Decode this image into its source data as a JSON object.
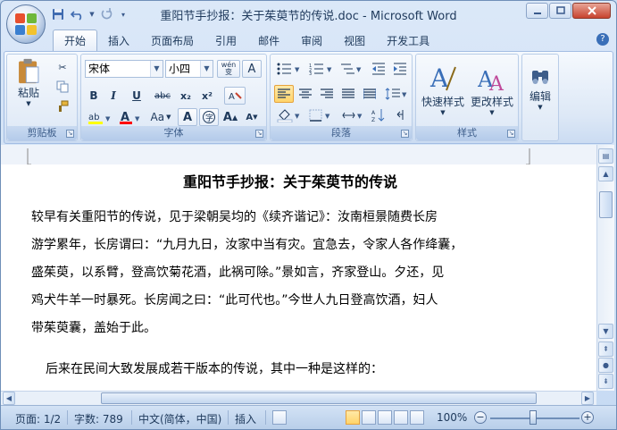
{
  "window": {
    "title": "重阳节手抄报：关于茱萸节的传说.doc - Microsoft Word"
  },
  "quick_access": {
    "icons": [
      "save-icon",
      "undo-icon",
      "redo-icon",
      "customize-icon"
    ]
  },
  "tabs": [
    {
      "label": "开始",
      "active": true
    },
    {
      "label": "插入",
      "active": false
    },
    {
      "label": "页面布局",
      "active": false
    },
    {
      "label": "引用",
      "active": false
    },
    {
      "label": "邮件",
      "active": false
    },
    {
      "label": "审阅",
      "active": false
    },
    {
      "label": "视图",
      "active": false
    },
    {
      "label": "开发工具",
      "active": false
    }
  ],
  "ribbon": {
    "clipboard": {
      "label": "剪贴板",
      "paste_label": "粘贴"
    },
    "font": {
      "label": "字体",
      "font_name": "宋体",
      "font_size": "小四",
      "wen_label": "wén 变",
      "a_label": "A",
      "bold": "B",
      "italic": "I",
      "underline": "U",
      "strike": "abc",
      "subscript": "x₂",
      "superscript": "x²",
      "aa_label": "Aa",
      "grow": "A",
      "shrink": "A",
      "highlight_color": "#ffff00",
      "font_color": "#ff0000"
    },
    "paragraph": {
      "label": "段落"
    },
    "styles": {
      "label": "样式",
      "quick_styles": "快速样式",
      "change_styles": "更改样式"
    },
    "editing": {
      "label": "编辑"
    }
  },
  "document": {
    "title": "重阳节手抄报：关于茱萸节的传说",
    "lines": [
      "较早有关重阳节的传说，见于梁朝吴均的《续齐谐记》：汝南桓景随费长房",
      "游学累年，长房谓曰：“九月九日，汝家中当有灾。宜急去，令家人各作绛囊，",
      "盛茱萸，以系臂，登高饮菊花酒，此祸可除。”景如言，齐家登山。夕还，见",
      "鸡犬牛羊一时暴死。长房闻之曰：“此可代也。”今世人九日登高饮酒，妇人",
      "带茱萸囊，盖始于此。",
      "后来在民间大致发展成若干版本的传说，其中一种是这样的："
    ]
  },
  "status_bar": {
    "page": "页面: 1/2",
    "words": "字数: 789",
    "language": "中文(简体，中国)",
    "mode": "插入",
    "zoom": "100%",
    "zoom_minus": "−",
    "zoom_plus": "+"
  },
  "colors": {
    "ribbon_bg": "#dde8f6",
    "accent_selected": "#ffd46a",
    "title_text": "#1e395b"
  }
}
